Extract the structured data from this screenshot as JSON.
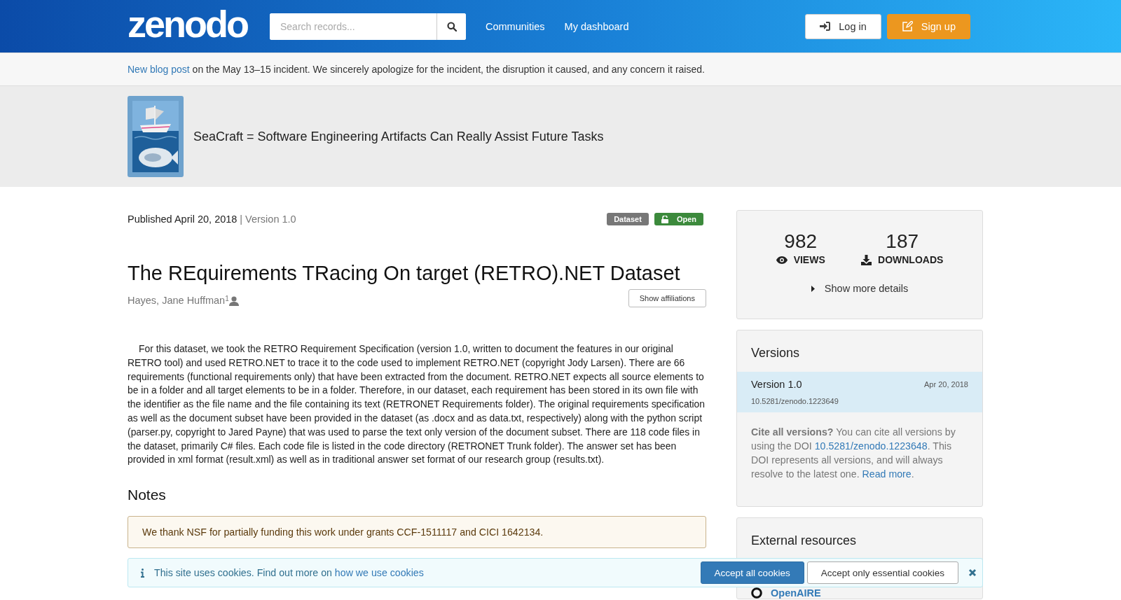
{
  "header": {
    "logo": "zenodo",
    "search": {
      "placeholder": "Search records..."
    },
    "nav": [
      "Communities",
      "My dashboard"
    ],
    "login": "Log in",
    "signup": "Sign up"
  },
  "announcement": {
    "link": "New blog post",
    "text": " on the May 13–15 incident. We sincerely apologize for the incident, the disruption it caused, and any concern it raised."
  },
  "community": {
    "title": "SeaCraft = Software Engineering Artifacts Can Really Assist Future Tasks"
  },
  "record": {
    "published": "Published April 20, 2018",
    "separator": "|",
    "version": "Version 1.0",
    "badges": [
      {
        "kind": "type",
        "label": "Dataset"
      },
      {
        "kind": "access",
        "label": "Open"
      }
    ],
    "title": "The REquirements TRacing On target (RETRO).NET Dataset",
    "creators": [
      {
        "name": "Hayes, Jane Huffman",
        "affiliation_mark": "1"
      }
    ],
    "show_affiliations": "Show affiliations",
    "description": "For this dataset, we took the RETRO Requirement Specification (version 1.0, written to document the features in our original RETRO tool) and used RETRO.NET to trace it to the code used to implement RETRO.NET (copyright Jody Larsen).  There are 66 requirements (functional requirements only) that have been extracted from the document.  RETRO.NET expects all source elements to be in a folder and all target elements to be in a folder.  Therefore, in our dataset, each requirement has been stored in its own file with the identifier as the file name and the file containing its text (RETRONET Requirements folder).  The original requirements specification as well as the document subset have been provided in the dataset (as .docx and as data.txt, respectively) along with the python script (parser.py, copyright to Jared Payne) that was used to parse the text only version of the document subset.  There are 118 code files in the dataset, primarily C# files.  Each code file is listed in the code directory (RETRONET Trunk folder).  The answer set has been provided in xml format (result.xml) as well as in traditional answer set format of our research group (results.txt).",
    "notes_heading": "Notes",
    "notes": "We thank NSF for partially funding this work under grants CCF-1511117 and CICI 1642134."
  },
  "stats": {
    "items": [
      {
        "kind": "views",
        "value": "982",
        "label": "VIEWS"
      },
      {
        "kind": "downloads",
        "value": "187",
        "label": "DOWNLOADS"
      }
    ],
    "more": "Show more details"
  },
  "versions": {
    "heading": "Versions",
    "items": [
      {
        "label": "Version 1.0",
        "date": "Apr 20, 2018",
        "doi": "10.5281/zenodo.1223649",
        "selected": true
      }
    ],
    "cite": {
      "lead": "Cite all versions?",
      "before": " You can cite all versions by using the DOI ",
      "doi": "10.5281/zenodo.1223648",
      "middle": ". This DOI represents all versions, and will always resolve to the latest one. ",
      "link": "Read more",
      "after": "."
    }
  },
  "external": {
    "heading": "External resources",
    "items": [
      {
        "label": "OpenAIRE"
      }
    ]
  },
  "cookies": {
    "text": "This site uses cookies. Find out more on ",
    "link": "how we use cookies",
    "accept_all": "Accept all cookies",
    "accept_essential": "Accept only essential cookies"
  }
}
